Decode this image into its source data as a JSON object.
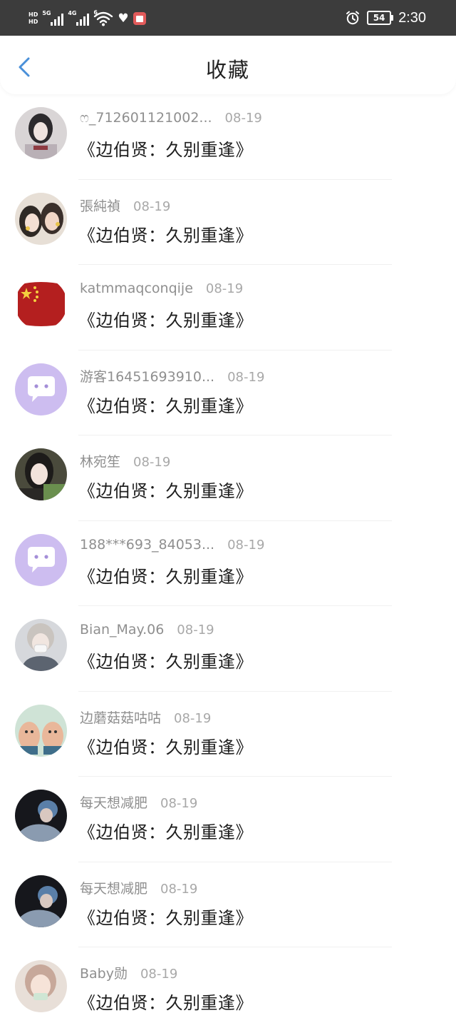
{
  "status_bar": {
    "hd_top": "HD",
    "hd_bottom": "HD",
    "network_1": "5G",
    "network_2": "4G",
    "wifi_badge": "6",
    "battery": "54",
    "time": "2:30"
  },
  "header": {
    "title": "收藏"
  },
  "list": [
    {
      "name": "ෆ_712601121002...",
      "date": "08-19",
      "work": "《边伯贤：久别重逢》"
    },
    {
      "name": "張純禎",
      "date": "08-19",
      "work": "《边伯贤：久别重逢》"
    },
    {
      "name": "katmmaqconqije",
      "date": "08-19",
      "work": "《边伯贤：久别重逢》"
    },
    {
      "name": "游客16451693910...",
      "date": "08-19",
      "work": "《边伯贤：久别重逢》"
    },
    {
      "name": "林宛笙",
      "date": "08-19",
      "work": "《边伯贤：久别重逢》"
    },
    {
      "name": "188***693_84053...",
      "date": "08-19",
      "work": "《边伯贤：久别重逢》"
    },
    {
      "name": "Bian_May.06",
      "date": "08-19",
      "work": "《边伯贤：久别重逢》"
    },
    {
      "name": "边蘑菇菇咕咕",
      "date": "08-19",
      "work": "《边伯贤：久别重逢》"
    },
    {
      "name": "每天想减肥",
      "date": "08-19",
      "work": "《边伯贤：久别重逢》"
    },
    {
      "name": "每天想减肥",
      "date": "08-19",
      "work": "《边伯贤：久别重逢》"
    },
    {
      "name": "Baby勋",
      "date": "08-19",
      "work": "《边伯贤：久别重逢》"
    }
  ],
  "colors": {
    "accent": "#4a90d9",
    "status_bar": "#3c3c3c",
    "default_avatar": "#cdbdf0"
  }
}
